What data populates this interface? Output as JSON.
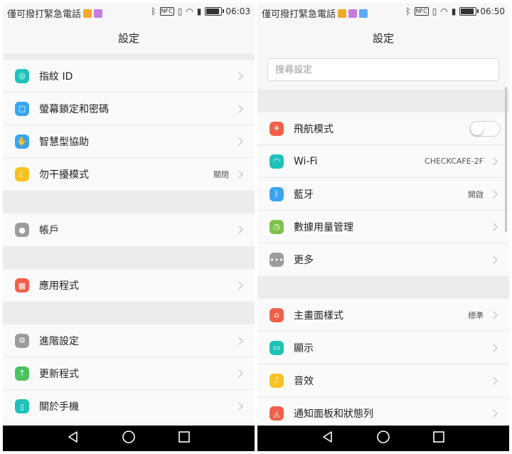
{
  "left": {
    "status": {
      "carrier": "僅可撥打緊急電話",
      "time": "06:03",
      "nfc_label": "NFC",
      "badge_colors": [
        "#f4a92a",
        "#c77be0"
      ]
    },
    "title": "設定",
    "groups": [
      [
        {
          "label": "指紋 ID",
          "icon": "fingerprint-icon",
          "color": "#1fc1b8",
          "glyph": "◎"
        },
        {
          "label": "螢幕鎖定和密碼",
          "icon": "lock-screen-icon",
          "color": "#3aa5ee",
          "glyph": "▢"
        },
        {
          "label": "智慧型協助",
          "icon": "hand-icon",
          "color": "#3aa5ee",
          "glyph": "✋"
        },
        {
          "label": "勿干擾模式",
          "icon": "moon-icon",
          "color": "#f7c222",
          "glyph": "☾",
          "value": "關閉"
        }
      ],
      [
        {
          "label": "帳戶",
          "icon": "account-icon",
          "color": "#9c9c9c",
          "glyph": "●"
        }
      ],
      [
        {
          "label": "應用程式",
          "icon": "apps-icon",
          "color": "#f0604a",
          "glyph": "▦"
        }
      ],
      [
        {
          "label": "進階設定",
          "icon": "gear-icon",
          "color": "#9c9c9c",
          "glyph": "⚙"
        },
        {
          "label": "更新程式",
          "icon": "update-arrow-icon",
          "color": "#4cc260",
          "glyph": "↑"
        },
        {
          "label": "關於手機",
          "icon": "phone-info-icon",
          "color": "#1fc1b8",
          "glyph": "▯"
        }
      ]
    ]
  },
  "right": {
    "status": {
      "carrier": "僅可撥打緊急電話",
      "time": "06:50",
      "nfc_label": "NFC",
      "badge_colors": [
        "#f4a92a",
        "#c77be0",
        "#5aa9f2"
      ]
    },
    "title": "設定",
    "search_placeholder": "搜尋設定",
    "groups": [
      [
        {
          "label": "飛航模式",
          "icon": "airplane-icon",
          "color": "#f0604a",
          "glyph": "✈",
          "toggle": true
        },
        {
          "label": "Wi-Fi",
          "icon": "wifi-icon",
          "color": "#1fc1b8",
          "glyph": "◠",
          "value": "CHECKCAFE-2F"
        },
        {
          "label": "藍牙",
          "icon": "bluetooth-icon",
          "color": "#3aa5ee",
          "glyph": "ᛒ",
          "value": "開啟"
        },
        {
          "label": "數據用量管理",
          "icon": "data-usage-icon",
          "color": "#7cc24b",
          "glyph": "◷"
        },
        {
          "label": "更多",
          "icon": "more-icon",
          "color": "#9c9c9c",
          "glyph": "•••"
        }
      ],
      [
        {
          "label": "主畫面樣式",
          "icon": "home-style-icon",
          "color": "#f0604a",
          "glyph": "⌂",
          "value": "標準"
        },
        {
          "label": "顯示",
          "icon": "display-icon",
          "color": "#1fc1b8",
          "glyph": "▭"
        },
        {
          "label": "音效",
          "icon": "sound-icon",
          "color": "#f7c222",
          "glyph": "♪"
        },
        {
          "label": "通知面板和狀態列",
          "icon": "notification-icon",
          "color": "#f0604a",
          "glyph": "◬"
        }
      ]
    ]
  }
}
